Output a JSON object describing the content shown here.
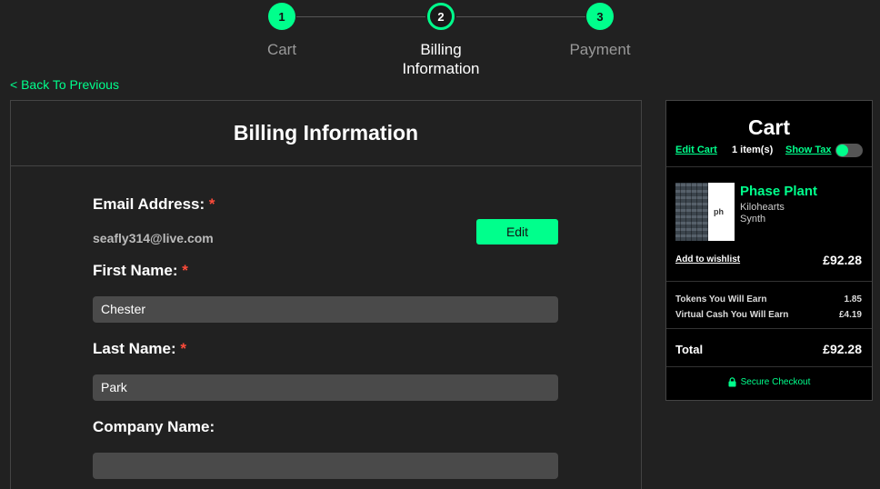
{
  "stepper": {
    "steps": [
      {
        "number": "1",
        "label": "Cart"
      },
      {
        "number": "2",
        "label_line1": "Billing",
        "label_line2": "Information"
      },
      {
        "number": "3",
        "label": "Payment"
      }
    ],
    "accent_color": "#00ff8c"
  },
  "back_link": "< Back To Previous",
  "billing": {
    "title": "Billing Information",
    "email_label": "Email Address:",
    "email_value": "seafly314@live.com",
    "edit_button": "Edit",
    "first_name_label": "First Name:",
    "first_name_value": "Chester",
    "last_name_label": "Last Name:",
    "last_name_value": "Park",
    "company_label": "Company Name:",
    "company_value": "",
    "required_mark": "*"
  },
  "cart": {
    "title": "Cart",
    "edit_cart": "Edit Cart",
    "items_count": "1 item(s)",
    "show_tax": "Show Tax",
    "show_tax_on": true,
    "product": {
      "name": "Phase Plant",
      "brand": "Kilohearts",
      "category": "Synth",
      "thumb_mark": "ph",
      "wishlist": "Add to wishlist",
      "price": "£92.28"
    },
    "tokens_label": "Tokens You Will Earn",
    "tokens_value": "1.85",
    "virtual_cash_label": "Virtual Cash You Will Earn",
    "virtual_cash_value": "£4.19",
    "total_label": "Total",
    "total_value": "£92.28",
    "secure_checkout": "Secure Checkout"
  }
}
